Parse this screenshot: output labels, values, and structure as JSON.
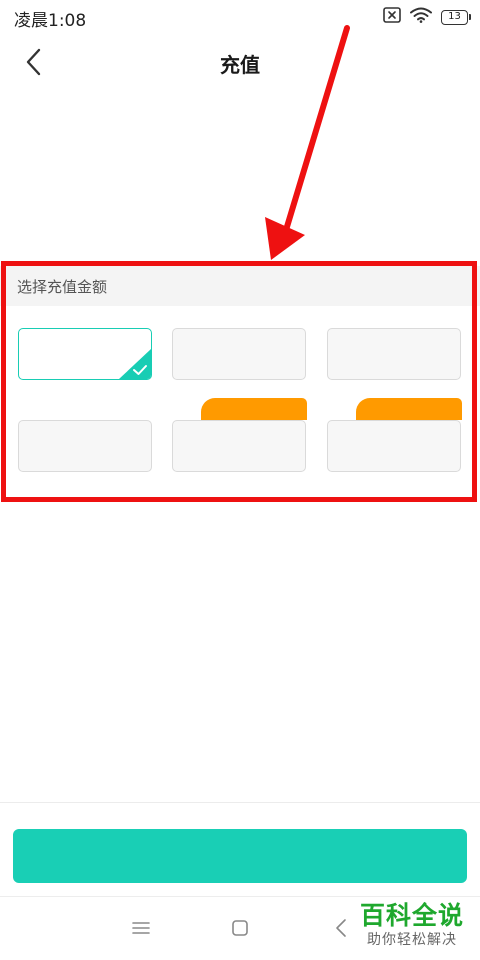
{
  "status_bar": {
    "time": "凌晨1:08",
    "battery_level": "13",
    "icons": [
      "no-sim-icon",
      "wifi-icon",
      "battery-icon"
    ]
  },
  "header": {
    "title": "充值",
    "back_icon": "chevron-left-icon"
  },
  "recharge": {
    "section_title": "选择充值金额",
    "options": [
      {
        "row": 1,
        "col": 1,
        "selected": true,
        "promo": false
      },
      {
        "row": 1,
        "col": 2,
        "selected": false,
        "promo": false
      },
      {
        "row": 1,
        "col": 3,
        "selected": false,
        "promo": false
      },
      {
        "row": 2,
        "col": 1,
        "selected": false,
        "promo": false
      },
      {
        "row": 2,
        "col": 2,
        "selected": false,
        "promo": true
      },
      {
        "row": 2,
        "col": 3,
        "selected": false,
        "promo": true
      }
    ]
  },
  "nav_bar": {
    "icons": [
      "menu-icon",
      "home-square-icon",
      "back-triangle-icon"
    ]
  },
  "watermark": {
    "main": "百科全说",
    "sub": "助你轻松解决"
  },
  "colors": {
    "accent": "#19cfb5",
    "promo": "#ff9a00",
    "highlight": "#ee1111",
    "watermark": "#1fa82e"
  }
}
